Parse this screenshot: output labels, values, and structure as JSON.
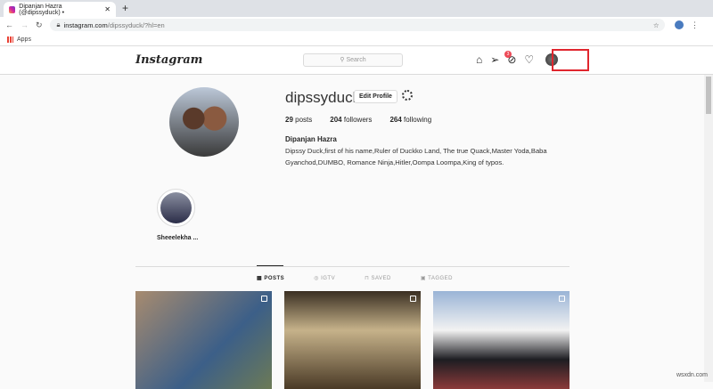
{
  "browser": {
    "tab_title": "Dipanjan Hazra (@dipssyduck) •",
    "url_host": "instagram.com",
    "url_path": "/dipssyduck/?hl=en",
    "bookmarks": [
      "Apps"
    ]
  },
  "nav": {
    "logo": "Instagram",
    "search_placeholder": "Search",
    "badge": "3"
  },
  "profile": {
    "username": "dipssyduck",
    "edit_label": "Edit Profile",
    "posts": "29",
    "posts_label": "posts",
    "followers": "204",
    "followers_label": "followers",
    "following": "264",
    "following_label": "following",
    "full_name": "Dipanjan Hazra",
    "bio": "Dipssy Duck,first of his name,Ruler of Duckko Land, The true Quack,Master Yoda,Baba Gyanchod,DUMBO, Romance Ninja,Hitler,Oompa Loompa,King of typos."
  },
  "highlights": [
    {
      "label": "Sheeelekha ..."
    }
  ],
  "tabs": [
    "POSTS",
    "IGTV",
    "SAVED",
    "TAGGED"
  ],
  "watermark": "wsxdn.com"
}
